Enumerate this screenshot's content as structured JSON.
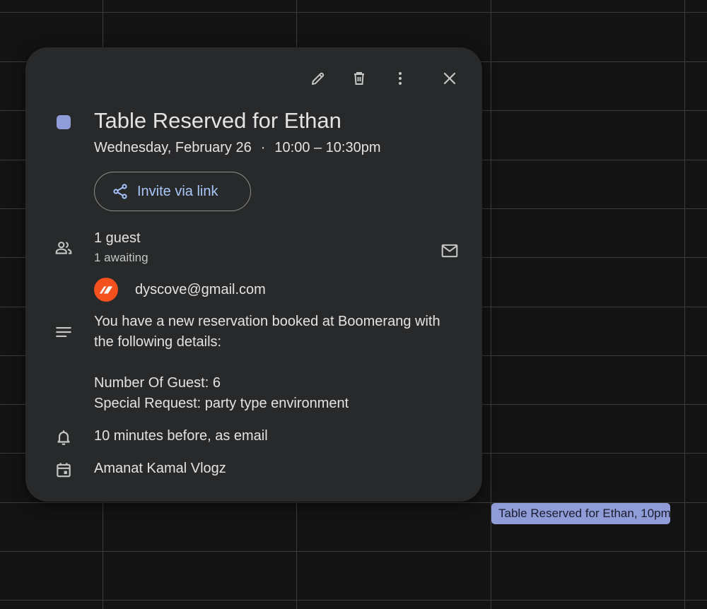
{
  "event": {
    "title": "Table Reserved for Ethan",
    "date": "Wednesday, February 26",
    "separator": "·",
    "time": "10:00 – 10:30pm",
    "color": "#8f9cd8"
  },
  "toolbar": {
    "edit_icon": "pencil-icon",
    "delete_icon": "trash-icon",
    "more_icon": "more-vert-icon",
    "close_icon": "close-icon"
  },
  "invite": {
    "label": "Invite via link",
    "icon": "share-icon"
  },
  "guests": {
    "count": "1 guest",
    "status": "1 awaiting",
    "items": [
      {
        "email": "dyscove@gmail.com",
        "avatar_color": "#f4511e"
      }
    ]
  },
  "description": {
    "line1": "You have a new reservation booked at Boomerang with",
    "line2": "the following details:",
    "line3": "Number Of Guest: 6",
    "line4": "Special Request: party type environment"
  },
  "reminder": {
    "text": "10 minutes before, as email"
  },
  "calendar": {
    "name": "Amanat Kamal Vlogz"
  },
  "chip": {
    "label": "Table Reserved for Ethan, 10pm"
  }
}
